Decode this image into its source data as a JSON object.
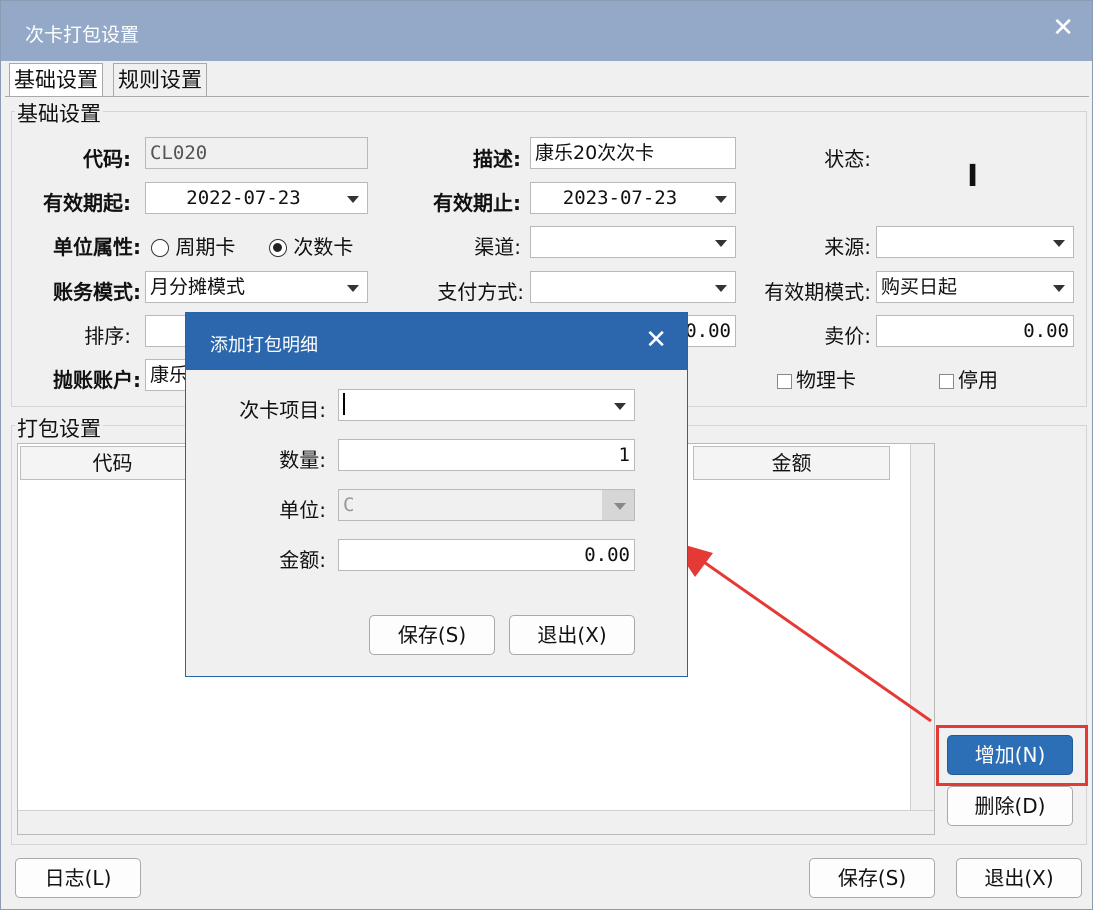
{
  "window": {
    "title": "次卡打包设置",
    "close": "✕"
  },
  "tabs": [
    {
      "label": "基础设置"
    },
    {
      "label": "规则设置"
    }
  ],
  "basic": {
    "group_title": "基础设置",
    "code_label": "代码:",
    "code_value": "CL020",
    "desc_label": "描述:",
    "desc_value": "康乐20次次卡",
    "status_label": "状态:",
    "status_value": "I",
    "valid_from_label": "有效期起:",
    "valid_from_value": "2022-07-23",
    "valid_to_label": "有效期止:",
    "valid_to_value": "2023-07-23",
    "unit_attr_label": "单位属性:",
    "radio_period": "周期卡",
    "radio_count": "次数卡",
    "channel_label": "渠道:",
    "channel_value": "",
    "source_label": "来源:",
    "source_value": "",
    "account_mode_label": "账务模式:",
    "account_mode_value": "月分摊模式",
    "pay_method_label": "支付方式:",
    "pay_method_value": "",
    "valid_mode_label": "有效期模式:",
    "valid_mode_value": "购买日起",
    "sort_label": "排序:",
    "sort_value": "",
    "hidden_amount_value": "0.00",
    "price_label": "卖价:",
    "price_value": "0.00",
    "account_label": "抛账账户:",
    "account_value": "康乐",
    "physical_card": "物理卡",
    "disabled": "停用"
  },
  "package": {
    "group_title": "打包设置",
    "columns": [
      {
        "label": "代码"
      },
      {
        "label": "金额"
      }
    ]
  },
  "buttons": {
    "add": "增加(N)",
    "delete": "删除(D)",
    "log": "日志(L)",
    "save": "保存(S)",
    "exit": "退出(X)"
  },
  "dialog": {
    "title": "添加打包明细",
    "close": "✕",
    "item_label": "次卡项目:",
    "item_value": "",
    "qty_label": "数量:",
    "qty_value": "1",
    "unit_label": "单位:",
    "unit_value": "C",
    "amount_label": "金额:",
    "amount_value": "0.00",
    "save": "保存(S)",
    "exit": "退出(X)"
  },
  "colors": {
    "titlebar": "#94a9c7",
    "dialog_titlebar": "#2c67ad",
    "primary": "#2d6fb6",
    "highlight": "#e53935"
  }
}
